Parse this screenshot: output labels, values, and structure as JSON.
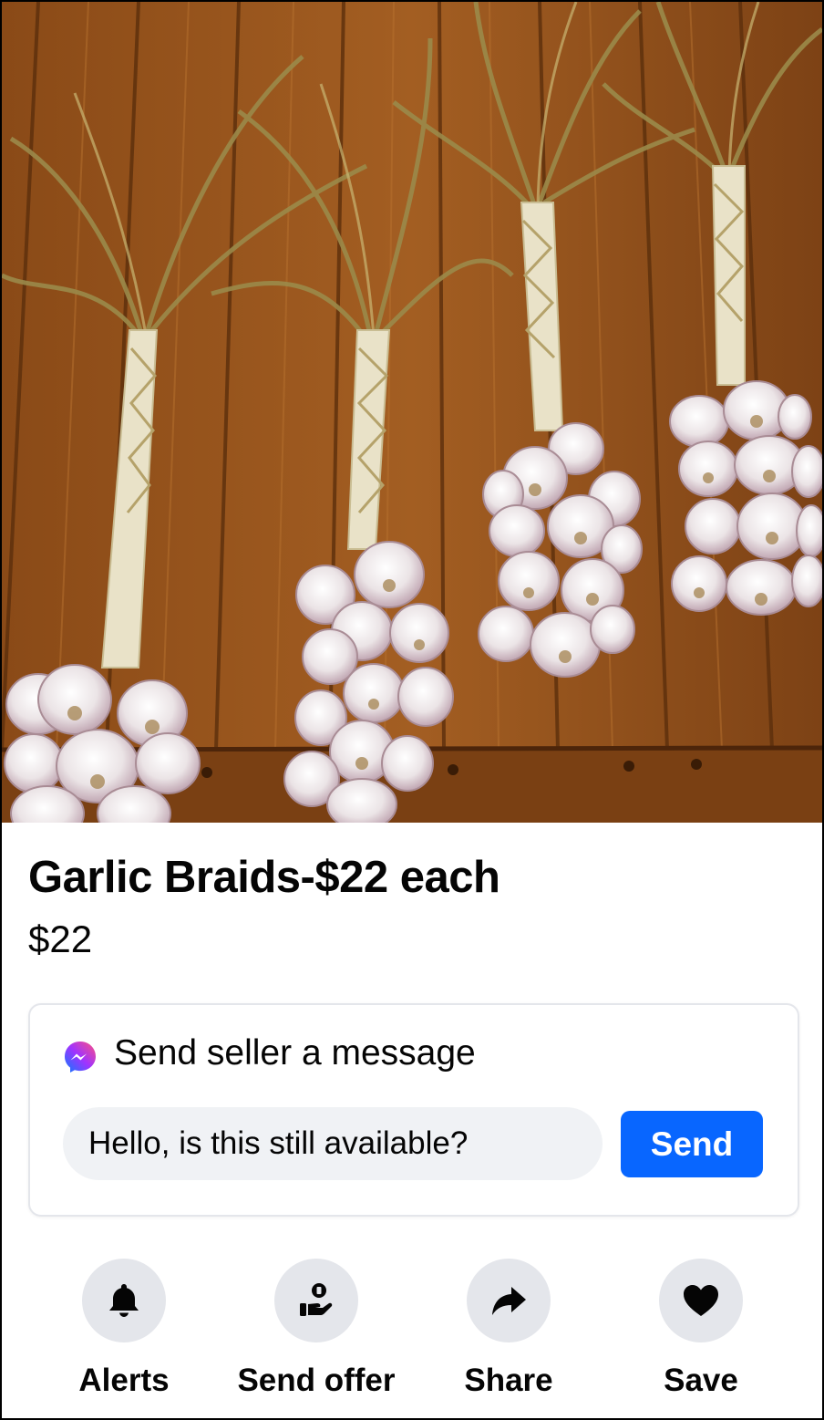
{
  "listing": {
    "title": "Garlic Braids-$22 each",
    "price": "$22"
  },
  "message": {
    "heading": "Send seller a message",
    "input_value": "Hello, is this still available?",
    "send_label": "Send"
  },
  "actions": [
    {
      "label": "Alerts",
      "icon": "bell-icon"
    },
    {
      "label": "Send offer",
      "icon": "offer-icon"
    },
    {
      "label": "Share",
      "icon": "share-arrow-icon"
    },
    {
      "label": "Save",
      "icon": "heart-icon"
    }
  ],
  "colors": {
    "send_button": "#0866ff",
    "input_bg": "#f0f2f5",
    "action_circle": "#e4e6eb"
  }
}
